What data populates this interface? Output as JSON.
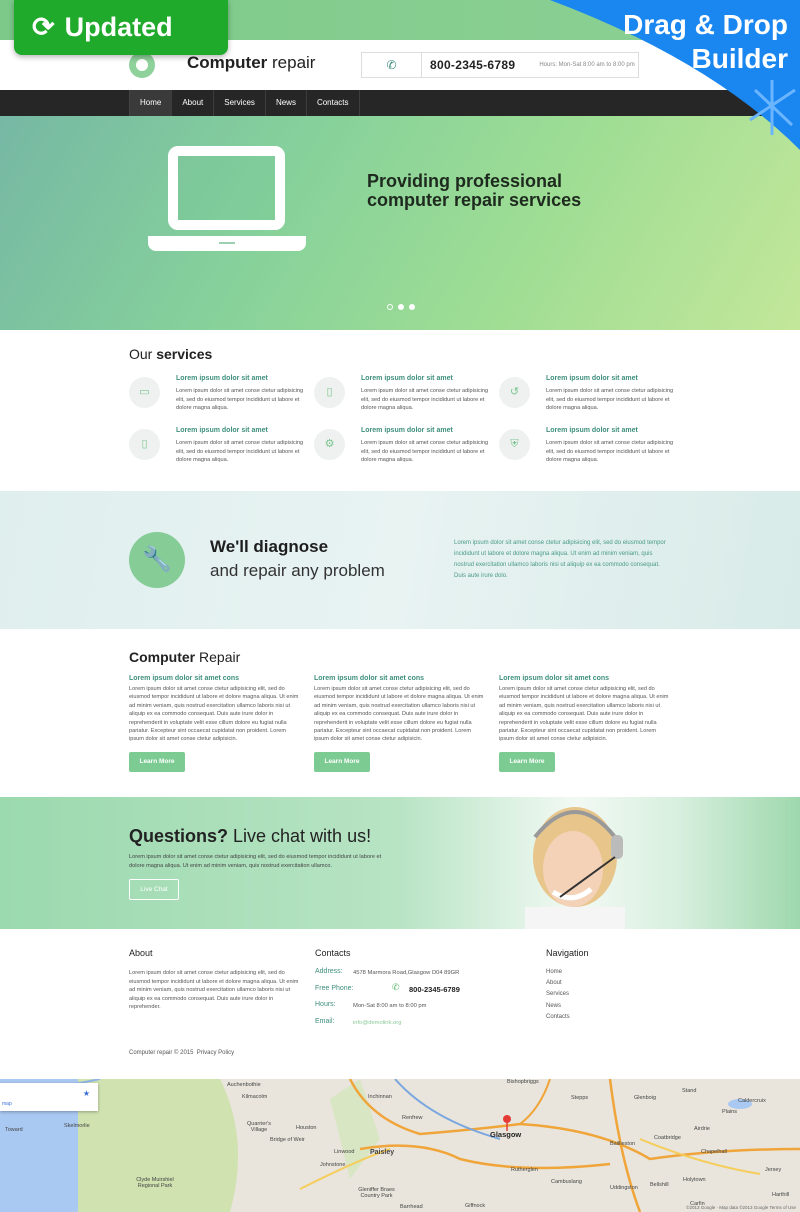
{
  "badges": {
    "updated": "Updated",
    "builder_line1": "Drag & Drop",
    "builder_line2": "Builder",
    "updated_color": "#1faa2b",
    "builder_color": "#1a86f0"
  },
  "header": {
    "logo_bold": "Computer",
    "logo_light": " repair",
    "phone": "800-2345-6789",
    "hours": "Hours: Mon-Sat 8:00 am to 8:00 pm"
  },
  "nav": {
    "items": [
      {
        "label": "Home",
        "active": true
      },
      {
        "label": "About"
      },
      {
        "label": "Services"
      },
      {
        "label": "News"
      },
      {
        "label": "Contacts"
      }
    ]
  },
  "hero": {
    "title": "Providing professional computer repair services",
    "slides": 3,
    "active_slide": 1
  },
  "services": {
    "title_light": "Our ",
    "title_bold": "services",
    "items": [
      {
        "icon": "laptop-icon",
        "title": "Lorem ipsum dolor sit amet",
        "text": "Lorem ipsum dolor sit amet conse ctetur adipisicing elit, sed do eiusmod tempor incididunt ut labore et dolore magna aliqua."
      },
      {
        "icon": "tablet-icon",
        "title": "Lorem ipsum dolor sit amet",
        "text": "Lorem ipsum dolor sit amet conse ctetur adipisicing elit, sed do eiusmod tempor incididunt ut labore et dolore magna aliqua."
      },
      {
        "icon": "history-icon",
        "title": "Lorem ipsum dolor sit amet",
        "text": "Lorem ipsum dolor sit amet conse ctetur adipisicing elit, sed do eiusmod tempor incididunt ut labore et dolore magna aliqua."
      },
      {
        "icon": "phone-icon",
        "title": "Lorem ipsum dolor sit amet",
        "text": "Lorem ipsum dolor sit amet conse ctetur adipisicing elit, sed do eiusmod tempor incididunt ut labore et dolore magna aliqua."
      },
      {
        "icon": "gears-icon",
        "title": "Lorem ipsum dolor sit amet",
        "text": "Lorem ipsum dolor sit amet conse ctetur adipisicing elit, sed do eiusmod tempor incididunt ut labore et dolore magna aliqua."
      },
      {
        "icon": "shield-icon",
        "title": "Lorem ipsum dolor sit amet",
        "text": "Lorem ipsum dolor sit amet conse ctetur adipisicing elit, sed do eiusmod tempor incididunt ut labore et dolore magna aliqua."
      }
    ]
  },
  "diagnose": {
    "line1": "We'll diagnose",
    "line2": "and repair any problem",
    "text": "Lorem ipsum dolor sit amet conse ctetur adipisicing elit, sed do eiusmod tempor incididunt ut labore et dolore magna aliqua. Ut enim ad minim veniam, quis nostrud exercitation ullamco laboris nisi ut aliquip ex ea commodo consequat. Duis aute irure dolo."
  },
  "repair": {
    "title_bold": "Computer",
    "title_light": " Repair",
    "columns": [
      {
        "title": "Lorem ipsum dolor sit amet cons",
        "text": "Lorem ipsum dolor sit amet conse ctetur adipisicing elit, sed do eiusmod tempor incididunt ut labore et dolore magna aliqua. Ut enim ad minim veniam, quis nostrud exercitation ullamco laboris nisi ut aliquip ex ea commodo consequat. Duis aute irure dolor in reprehenderit in voluptate velit esse cillum dolore eu fugiat nulla pariatur. Excepteur sint occaecat cupidatat non proident. Lorem ipsum dolor sit amet conse ctetur adipisicin.",
        "button": "Learn More"
      },
      {
        "title": "Lorem ipsum dolor sit amet cons",
        "text": "Lorem ipsum dolor sit amet conse ctetur adipisicing elit, sed do eiusmod tempor incididunt ut labore et dolore magna aliqua. Ut enim ad minim veniam, quis nostrud exercitation ullamco laboris nisi ut aliquip ex ea commodo consequat. Duis aute irure dolor in reprehenderit in voluptate velit esse cillum dolore eu fugiat nulla pariatur. Excepteur sint occaecat cupidatat non proident. Lorem ipsum dolor sit amet conse ctetur adipisicin.",
        "button": "Learn More"
      },
      {
        "title": "Lorem ipsum dolor sit amet cons",
        "text": "Lorem ipsum dolor sit amet conse ctetur adipisicing elit, sed do eiusmod tempor incididunt ut labore et dolore magna aliqua. Ut enim ad minim veniam, quis nostrud exercitation ullamco laboris nisi ut aliquip ex ea commodo consequat. Duis aute irure dolor in reprehenderit in voluptate velit esse cillum dolore eu fugiat nulla pariatur. Excepteur sint occaecat cupidatat non proident. Lorem ipsum dolor sit amet conse ctetur adipisicin.",
        "button": "Learn More"
      }
    ]
  },
  "questions": {
    "title_bold": "Questions?",
    "title_light": " Live chat with us!",
    "text": "Lorem ipsum dolor sit amet conse ctetur adipisicing elit, sed do eiusmod tempor incididunt ut labore et dolore magna aliqua. Ut enim ad minim veniam, quis nostrud exercitation ullamco.",
    "button": "Live Chat"
  },
  "footer": {
    "about_title": "About",
    "about_text": "Lorem ipsum dolor sit amet conse ctetur adipisicing elit, sed do eiusmod tempor incididunt ut labore et dolore magna aliqua. Ut enim ad minim veniam, quis nostrud exercitation ullamco laboris nisi ut aliquip ex ea commodo consequat. Duis aute irure dolor in reprehender.",
    "contacts_title": "Contacts",
    "address_label": "Address:",
    "address": "4578 Marmora Road,Glasgow D04 89GR",
    "phone_label": "Free Phone:",
    "phone": "800-2345-6789",
    "hours_label": "Hours:",
    "hours": "Mon-Sat 8:00 am to 8:00 pm",
    "email_label": "Email:",
    "email": "info@demolink.org",
    "nav_title": "Navigation",
    "nav_items": [
      "Home",
      "About",
      "Services",
      "News",
      "Contacts"
    ],
    "copyright": "Computer repair © 2015",
    "privacy": "Privacy Policy"
  },
  "map": {
    "card_link": "map",
    "places": [
      "Auchenbothie",
      "Kilmacolm",
      "Skelmorlie",
      "Toward",
      "Quarrier's Village",
      "Houston",
      "Bridge of Weir",
      "Linwood",
      "Paisley",
      "Johnstone",
      "Clyde Muirshiel Regional Park",
      "Gleniffer Braes Country Park",
      "Renfrew",
      "Glasgow",
      "Bishopbriggs",
      "Stepps",
      "Glenboig",
      "Coatbridge",
      "Airdrie",
      "Caldercruix",
      "Chapelhall",
      "Rutherglen",
      "Cambuslang",
      "Uddingston",
      "Bellshill",
      "Holytown",
      "Giffnock",
      "Barrhead",
      "Jersey",
      "Harthill",
      "Inchinnan",
      "Stand",
      "Plains",
      "Baillieston",
      "Carfin"
    ],
    "attribution": "©2013 Google · Map data ©2013 Google   Terms of Use"
  }
}
